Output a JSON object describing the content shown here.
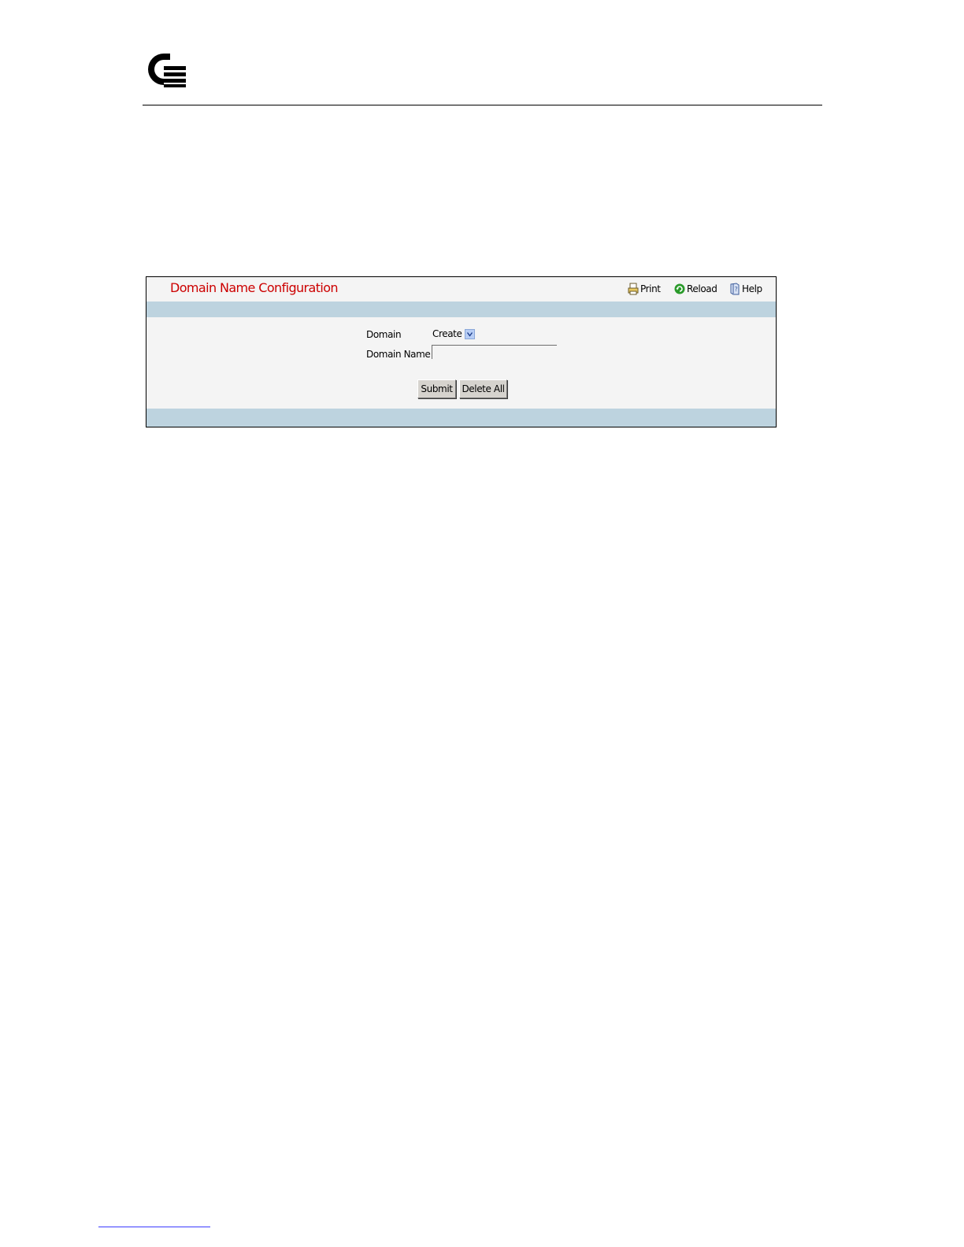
{
  "panel": {
    "title": "Domain Name Configuration",
    "toolbar": {
      "print_label": "Print",
      "reload_label": "Reload",
      "help_label": "Help"
    }
  },
  "form": {
    "domain_label": "Domain",
    "domain_select_value": "Create",
    "domain_name_label": "Domain Name",
    "domain_name_value": ""
  },
  "buttons": {
    "submit_label": "Submit",
    "delete_all_label": "Delete All"
  },
  "colors": {
    "title_red": "#cc0000",
    "band_blue": "#bdd3df",
    "panel_bg": "#f4f4f4",
    "button_face": "#d6d3ce"
  },
  "icons": {
    "logo": "q-logo-icon",
    "print": "printer-icon",
    "reload": "reload-icon",
    "help": "help-icon",
    "dropdown": "chevron-down-icon"
  }
}
